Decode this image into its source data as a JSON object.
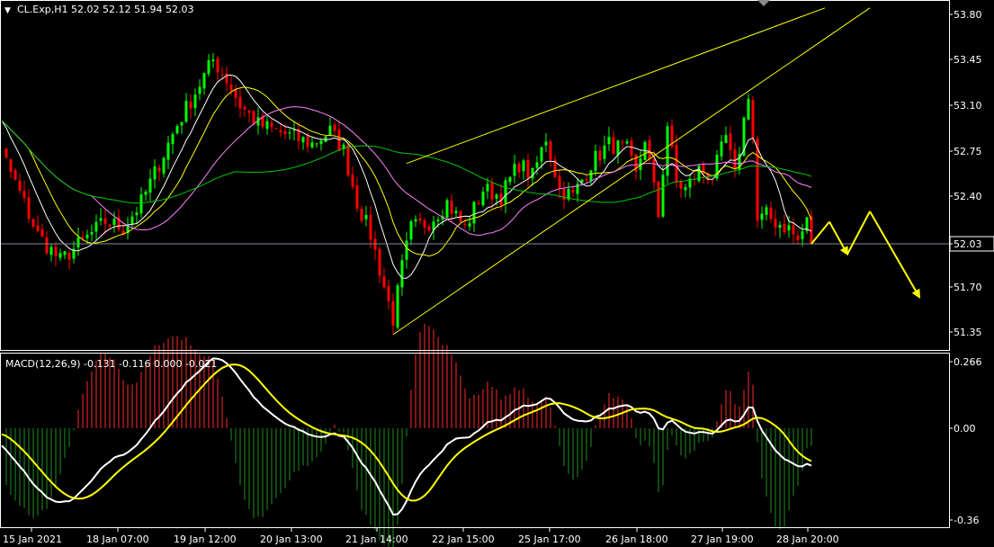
{
  "header": {
    "menu_glyph": "▼",
    "symbol_info": "CL.Exp,H1  52.02 52.12 51.94 52.03"
  },
  "macd_header": "MACD(12,26,9) -0.131 -0.116 0.000 -0.021",
  "colors": {
    "background": "#000000",
    "axis": "#ffffff",
    "bull": "#00ff00",
    "bear": "#ff0000",
    "ma_fast": "#ffffff",
    "ma_mid": "#ffff00",
    "ma_slow": "#ff80ff",
    "ma_long": "#00c800",
    "trendline": "#ffff00",
    "projection": "#ffff00",
    "current_line": "#808b9c",
    "macd_line": "#ffffff",
    "signal_line": "#ffff00",
    "hist_pos": "#ff2a2a",
    "hist_neg": "#1f8f1f"
  },
  "chart_data": [
    {
      "type": "candlestick",
      "symbol": "CL.Exp",
      "timeframe": "H1",
      "ylim": [
        51.22,
        53.92
      ],
      "y_ticks": [
        "53.80",
        "53.45",
        "53.10",
        "52.75",
        "52.40",
        "52.03",
        "51.70",
        "51.35"
      ],
      "current_price_label": "52.03",
      "current_price": 52.03,
      "x_tick_labels": [
        "15 Jan 2021",
        "18 Jan 07:00",
        "19 Jan 12:00",
        "20 Jan 13:00",
        "21 Jan 14:00",
        "22 Jan 15:00",
        "25 Jan 17:00",
        "26 Jan 18:00",
        "27 Jan 19:00",
        "28 Jan 20:00"
      ],
      "close_path": [
        [
          0,
          53.2
        ],
        [
          5,
          52.9
        ],
        [
          10,
          52.5
        ],
        [
          15,
          52.1
        ],
        [
          20,
          51.9
        ],
        [
          25,
          52.05
        ],
        [
          30,
          52.2
        ],
        [
          34,
          52.15
        ],
        [
          38,
          52.35
        ],
        [
          42,
          52.65
        ],
        [
          46,
          52.95
        ],
        [
          50,
          53.2
        ],
        [
          54,
          53.45
        ],
        [
          57,
          53.3
        ],
        [
          60,
          53.1
        ],
        [
          64,
          52.95
        ],
        [
          68,
          52.9
        ],
        [
          72,
          52.85
        ],
        [
          76,
          52.8
        ],
        [
          80,
          52.9
        ],
        [
          83,
          52.75
        ],
        [
          86,
          52.35
        ],
        [
          89,
          52.1
        ],
        [
          92,
          51.7
        ],
        [
          94,
          51.45
        ],
        [
          96,
          51.85
        ],
        [
          98,
          52.15
        ],
        [
          102,
          52.2
        ],
        [
          106,
          52.35
        ],
        [
          110,
          52.15
        ],
        [
          114,
          52.45
        ],
        [
          118,
          52.4
        ],
        [
          122,
          52.65
        ],
        [
          125,
          52.55
        ],
        [
          128,
          52.85
        ],
        [
          131,
          52.45
        ],
        [
          134,
          52.4
        ],
        [
          138,
          52.65
        ],
        [
          142,
          52.8
        ],
        [
          146,
          52.75
        ],
        [
          148,
          52.55
        ],
        [
          150,
          52.85
        ],
        [
          153,
          52.25
        ],
        [
          155,
          52.95
        ],
        [
          157,
          52.5
        ],
        [
          159,
          52.45
        ],
        [
          162,
          52.6
        ],
        [
          165,
          52.55
        ],
        [
          168,
          52.85
        ],
        [
          170,
          52.55
        ],
        [
          173,
          53.2
        ],
        [
          174,
          52.85
        ],
        [
          175,
          52.2
        ],
        [
          177,
          52.25
        ],
        [
          179,
          52.2
        ],
        [
          182,
          52.15
        ],
        [
          184,
          52.05
        ],
        [
          186,
          52.2
        ],
        [
          187,
          52.03
        ]
      ],
      "moving_averages": [
        {
          "role": "fast",
          "color_key": "ma_fast",
          "period": 8
        },
        {
          "role": "mid",
          "color_key": "ma_mid",
          "period": 14
        },
        {
          "role": "slow",
          "color_key": "ma_slow",
          "period": 28
        },
        {
          "role": "long",
          "color_key": "ma_long",
          "period": 60
        }
      ],
      "trendlines": [
        {
          "bar0": 97,
          "p0": 52.65,
          "bar1": 190,
          "p1": 53.85
        },
        {
          "bar0": 94,
          "p0": 51.33,
          "bar1": 200,
          "p1": 53.85
        }
      ],
      "projection": {
        "points": [
          [
            0,
            52.03
          ],
          [
            4,
            52.2
          ],
          [
            8,
            51.95
          ],
          [
            13,
            52.28
          ],
          [
            24,
            51.62
          ]
        ],
        "step_px": 5,
        "arrow_segments": [
          1,
          3
        ]
      }
    },
    {
      "type": "line",
      "indicator": "MACD",
      "params": [
        12,
        26,
        9
      ],
      "ylim": [
        -0.36,
        0.266
      ],
      "y_ticks": [
        "0.266",
        "0.00",
        "-0.36"
      ],
      "y_tick_values": [
        0.266,
        0.0,
        -0.36
      ],
      "values": {
        "macd": -0.131,
        "signal": -0.116,
        "hist": -0.021
      }
    }
  ]
}
